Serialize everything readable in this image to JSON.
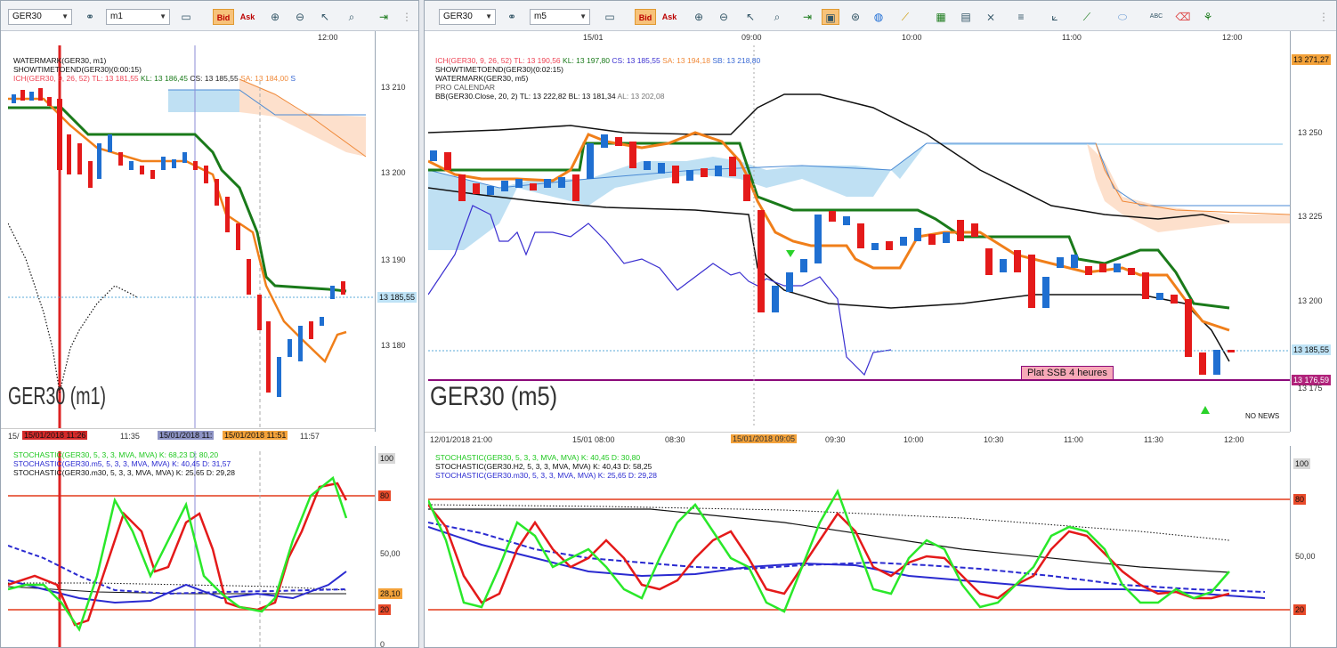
{
  "left_window": {
    "symbol": "GER30",
    "timeframe": "m1",
    "bid_label": "Bid",
    "ask_label": "Ask",
    "top_time_label": "12:00",
    "info_lines": [
      "WATERMARK(GER30, m1)",
      "SHOWTIMETOEND(GER30)(0:00:15)"
    ],
    "ich_line": {
      "prefix": "ICH(GER30, 9, 26, 52)",
      "tl": "TL: 13 181,55",
      "kl": "KL: 13 186,45",
      "cs": "CS: 13 185,55",
      "sa": "SA: 13 184,00",
      "s": "S"
    },
    "y_labels": [
      "13 210",
      "13 200",
      "13 190",
      "13 180"
    ],
    "current_price": "13 185,55",
    "watermark": "GER30 (m1)",
    "x_labels": [
      "15/",
      "15/01/2018 11:26",
      "11:35",
      "15/01/2018 11:",
      "15/01/2018 11:51",
      "11:57"
    ],
    "stoch_lines": [
      "STOCHASTIC(GER30, 5, 3, 3, MVA, MVA)  K: 68,23  D: 80,20",
      "STOCHASTIC(GER30.m5, 5, 3, 3, MVA, MVA)  K: 40,45  D: 31,57",
      "STOCHASTIC(GER30.m30, 5, 3, 3, MVA, MVA)  K: 25,65  D: 29,28"
    ],
    "stoch_y_labels": [
      "100",
      "80",
      "50,00",
      "20",
      "0"
    ],
    "stoch_value_box": "28,10"
  },
  "right_window": {
    "symbol": "GER30",
    "timeframe": "m5",
    "bid_label": "Bid",
    "ask_label": "Ask",
    "top_time_labels": [
      "15/01",
      "09:00",
      "10:00",
      "11:00",
      "12:00"
    ],
    "info_lines": [
      "SHOWTIMETOEND(GER30)(0:02:15)",
      "WATERMARK(GER30, m5)",
      "PRO CALENDAR"
    ],
    "ich_line": {
      "prefix": "ICH(GER30, 9, 26, 52)",
      "tl": "TL: 13 190,56",
      "kl": "KL: 13 197,80",
      "cs": "CS: 13 185,55",
      "sa": "SA: 13 194,18",
      "sb": "SB: 13 218,80"
    },
    "bb_line": {
      "prefix": "BB(GER30.Close, 20, 2)",
      "tl": "TL: 13 222,82",
      "bl": "BL: 13 181,34",
      "al": "AL: 13 202,08"
    },
    "y_labels": [
      "13 271,27",
      "13 250",
      "13 225",
      "13 200",
      "13 185,55",
      "13 176,59",
      "13 175"
    ],
    "watermark": "GER30 (m5)",
    "annotation": "Plat SSB 4 heures",
    "no_news": "NO NEWS",
    "x_labels": [
      "12/01/2018 21:00",
      "15/01 08:00",
      "08:30",
      "15/01/2018 09:05",
      "09:30",
      "10:00",
      "10:30",
      "11:00",
      "11:30",
      "12:00"
    ],
    "stoch_lines": [
      "STOCHASTIC(GER30, 5, 3, 3, MVA, MVA)  K: 40,45  D: 30,80",
      "STOCHASTIC(GER30.H2, 5, 3, 3, MVA, MVA)  K: 40,43  D: 58,25",
      "STOCHASTIC(GER30.m30, 5, 3, 3, MVA, MVA)  K: 25,65  D: 29,28"
    ],
    "stoch_y_labels": [
      "100",
      "80",
      "50,00",
      "20"
    ]
  },
  "colors": {
    "bull": "#1f6fd1",
    "bear": "#e41a1a",
    "kijun": "#1a7a1a",
    "tenkan": "#f07f1a",
    "cloud_blue": "#bfe0f3",
    "cloud_orange": "#fde0cc",
    "bb": "#111111",
    "chikou": "#3a2fd0",
    "annotation_line": "#8b0a7a"
  }
}
